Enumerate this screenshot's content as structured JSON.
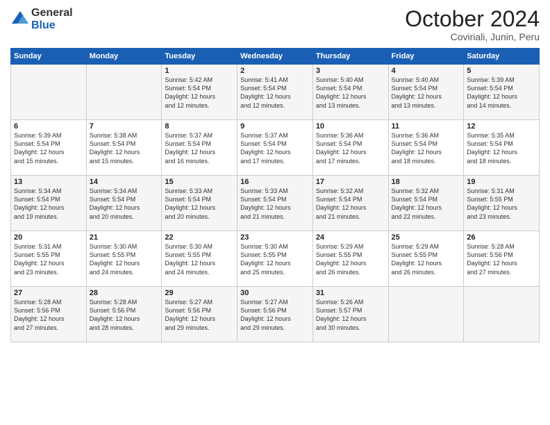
{
  "logo": {
    "general": "General",
    "blue": "Blue"
  },
  "header": {
    "month": "October 2024",
    "location": "Coviriali, Junin, Peru"
  },
  "weekdays": [
    "Sunday",
    "Monday",
    "Tuesday",
    "Wednesday",
    "Thursday",
    "Friday",
    "Saturday"
  ],
  "weeks": [
    [
      {
        "day": "",
        "content": ""
      },
      {
        "day": "",
        "content": ""
      },
      {
        "day": "1",
        "content": "Sunrise: 5:42 AM\nSunset: 5:54 PM\nDaylight: 12 hours\nand 12 minutes."
      },
      {
        "day": "2",
        "content": "Sunrise: 5:41 AM\nSunset: 5:54 PM\nDaylight: 12 hours\nand 12 minutes."
      },
      {
        "day": "3",
        "content": "Sunrise: 5:40 AM\nSunset: 5:54 PM\nDaylight: 12 hours\nand 13 minutes."
      },
      {
        "day": "4",
        "content": "Sunrise: 5:40 AM\nSunset: 5:54 PM\nDaylight: 12 hours\nand 13 minutes."
      },
      {
        "day": "5",
        "content": "Sunrise: 5:39 AM\nSunset: 5:54 PM\nDaylight: 12 hours\nand 14 minutes."
      }
    ],
    [
      {
        "day": "6",
        "content": "Sunrise: 5:39 AM\nSunset: 5:54 PM\nDaylight: 12 hours\nand 15 minutes."
      },
      {
        "day": "7",
        "content": "Sunrise: 5:38 AM\nSunset: 5:54 PM\nDaylight: 12 hours\nand 15 minutes."
      },
      {
        "day": "8",
        "content": "Sunrise: 5:37 AM\nSunset: 5:54 PM\nDaylight: 12 hours\nand 16 minutes."
      },
      {
        "day": "9",
        "content": "Sunrise: 5:37 AM\nSunset: 5:54 PM\nDaylight: 12 hours\nand 17 minutes."
      },
      {
        "day": "10",
        "content": "Sunrise: 5:36 AM\nSunset: 5:54 PM\nDaylight: 12 hours\nand 17 minutes."
      },
      {
        "day": "11",
        "content": "Sunrise: 5:36 AM\nSunset: 5:54 PM\nDaylight: 12 hours\nand 18 minutes."
      },
      {
        "day": "12",
        "content": "Sunrise: 5:35 AM\nSunset: 5:54 PM\nDaylight: 12 hours\nand 18 minutes."
      }
    ],
    [
      {
        "day": "13",
        "content": "Sunrise: 5:34 AM\nSunset: 5:54 PM\nDaylight: 12 hours\nand 19 minutes."
      },
      {
        "day": "14",
        "content": "Sunrise: 5:34 AM\nSunset: 5:54 PM\nDaylight: 12 hours\nand 20 minutes."
      },
      {
        "day": "15",
        "content": "Sunrise: 5:33 AM\nSunset: 5:54 PM\nDaylight: 12 hours\nand 20 minutes."
      },
      {
        "day": "16",
        "content": "Sunrise: 5:33 AM\nSunset: 5:54 PM\nDaylight: 12 hours\nand 21 minutes."
      },
      {
        "day": "17",
        "content": "Sunrise: 5:32 AM\nSunset: 5:54 PM\nDaylight: 12 hours\nand 21 minutes."
      },
      {
        "day": "18",
        "content": "Sunrise: 5:32 AM\nSunset: 5:54 PM\nDaylight: 12 hours\nand 22 minutes."
      },
      {
        "day": "19",
        "content": "Sunrise: 5:31 AM\nSunset: 5:55 PM\nDaylight: 12 hours\nand 23 minutes."
      }
    ],
    [
      {
        "day": "20",
        "content": "Sunrise: 5:31 AM\nSunset: 5:55 PM\nDaylight: 12 hours\nand 23 minutes."
      },
      {
        "day": "21",
        "content": "Sunrise: 5:30 AM\nSunset: 5:55 PM\nDaylight: 12 hours\nand 24 minutes."
      },
      {
        "day": "22",
        "content": "Sunrise: 5:30 AM\nSunset: 5:55 PM\nDaylight: 12 hours\nand 24 minutes."
      },
      {
        "day": "23",
        "content": "Sunrise: 5:30 AM\nSunset: 5:55 PM\nDaylight: 12 hours\nand 25 minutes."
      },
      {
        "day": "24",
        "content": "Sunrise: 5:29 AM\nSunset: 5:55 PM\nDaylight: 12 hours\nand 26 minutes."
      },
      {
        "day": "25",
        "content": "Sunrise: 5:29 AM\nSunset: 5:55 PM\nDaylight: 12 hours\nand 26 minutes."
      },
      {
        "day": "26",
        "content": "Sunrise: 5:28 AM\nSunset: 5:56 PM\nDaylight: 12 hours\nand 27 minutes."
      }
    ],
    [
      {
        "day": "27",
        "content": "Sunrise: 5:28 AM\nSunset: 5:56 PM\nDaylight: 12 hours\nand 27 minutes."
      },
      {
        "day": "28",
        "content": "Sunrise: 5:28 AM\nSunset: 5:56 PM\nDaylight: 12 hours\nand 28 minutes."
      },
      {
        "day": "29",
        "content": "Sunrise: 5:27 AM\nSunset: 5:56 PM\nDaylight: 12 hours\nand 29 minutes."
      },
      {
        "day": "30",
        "content": "Sunrise: 5:27 AM\nSunset: 5:56 PM\nDaylight: 12 hours\nand 29 minutes."
      },
      {
        "day": "31",
        "content": "Sunrise: 5:26 AM\nSunset: 5:57 PM\nDaylight: 12 hours\nand 30 minutes."
      },
      {
        "day": "",
        "content": ""
      },
      {
        "day": "",
        "content": ""
      }
    ]
  ]
}
